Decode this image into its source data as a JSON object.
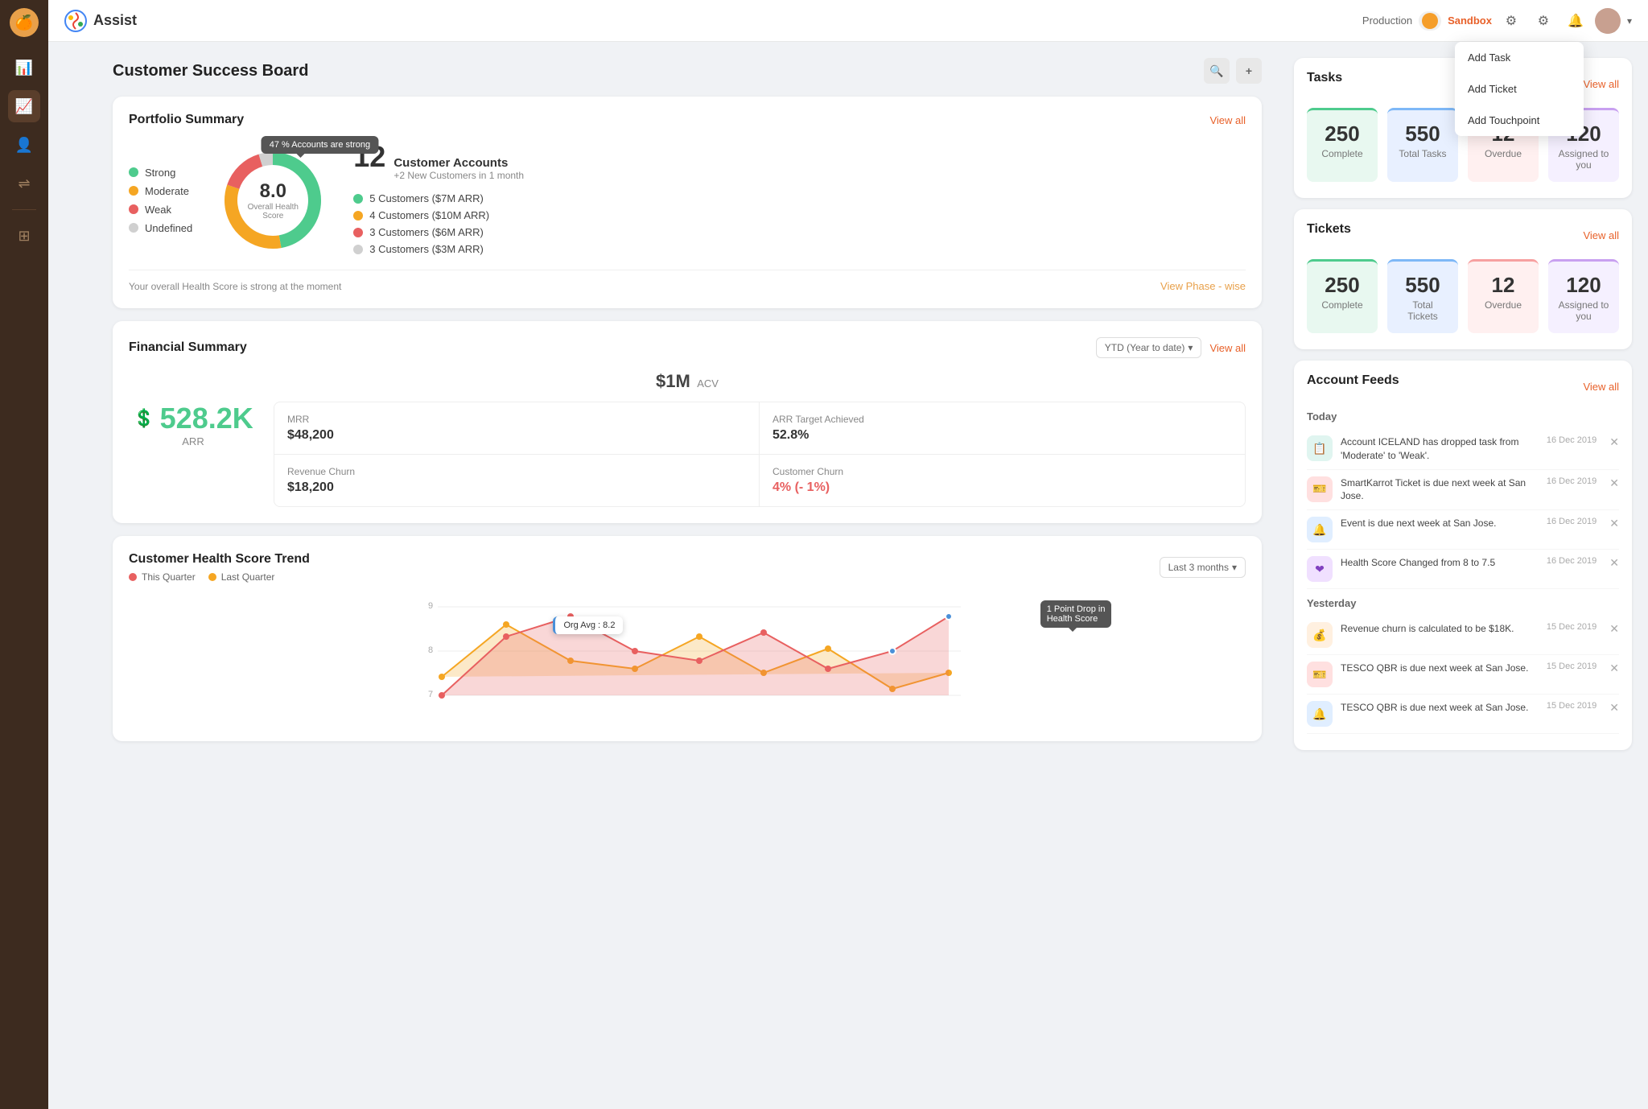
{
  "app": {
    "name": "Assist",
    "env_label": "Production",
    "env_active": "Sandbox"
  },
  "page": {
    "title": "Customer Success Board",
    "search_icon": "🔍",
    "add_icon": "+"
  },
  "sidebar": {
    "items": [
      {
        "id": "home",
        "icon": "⊞",
        "active": false
      },
      {
        "id": "dashboard",
        "icon": "📊",
        "active": true
      },
      {
        "id": "users",
        "icon": "👤",
        "active": false
      },
      {
        "id": "flows",
        "icon": "⇌",
        "active": false
      },
      {
        "id": "grid",
        "icon": "⊞",
        "active": false
      }
    ]
  },
  "dropdown_menu": {
    "items": [
      "Add Task",
      "Add Ticket",
      "Add Touchpoint"
    ]
  },
  "portfolio": {
    "title": "Portfolio Summary",
    "view_all": "View all",
    "tooltip": "47 % Accounts are strong",
    "health_score": "8.0",
    "health_label": "Overall Health Score",
    "footer_text": "Your overall Health Score is strong at the moment",
    "view_phase": "View Phase - wise",
    "legend": [
      {
        "label": "Strong",
        "color": "#4ecb8d"
      },
      {
        "label": "Moderate",
        "color": "#f5a623"
      },
      {
        "label": "Weak",
        "color": "#e86060"
      },
      {
        "label": "Undefined",
        "color": "#d0d0d0"
      }
    ],
    "accounts": {
      "count": "12",
      "title": "Customer Accounts",
      "subtitle": "+2 New Customers in 1 month",
      "items": [
        {
          "label": "5 Customers ($7M  ARR)",
          "color": "#4ecb8d"
        },
        {
          "label": "4 Customers ($10M ARR)",
          "color": "#f5a623"
        },
        {
          "label": "3 Customers ($6M  ARR)",
          "color": "#e86060"
        },
        {
          "label": "3 Customers ($3M  ARR)",
          "color": "#d0d0d0"
        }
      ]
    }
  },
  "tasks": {
    "title": "Tasks",
    "view_all": "View all",
    "stats": [
      {
        "value": "250",
        "label": "Complete",
        "style": "green"
      },
      {
        "value": "550",
        "label": "Total Tasks",
        "style": "blue"
      },
      {
        "value": "12",
        "label": "Overdue",
        "style": "red"
      },
      {
        "value": "120",
        "label": "Assigned to you",
        "style": "purple"
      }
    ]
  },
  "tickets": {
    "title": "Tickets",
    "view_all": "View all",
    "stats": [
      {
        "value": "250",
        "label": "Complete",
        "style": "green"
      },
      {
        "value": "550",
        "label": "Total Tickets",
        "style": "blue"
      },
      {
        "value": "12",
        "label": "Overdue",
        "style": "red"
      },
      {
        "value": "120",
        "label": "Assigned to you",
        "style": "purple"
      }
    ]
  },
  "financial": {
    "title": "Financial Summary",
    "view_all": "View all",
    "period": "YTD (Year to date)",
    "acv": "$1M",
    "acv_label": "ACV",
    "arr_amount": "528.2K",
    "arr_label": "ARR",
    "cells": [
      {
        "label": "MRR",
        "value": "$48,200"
      },
      {
        "label": "ARR Target Achieved",
        "value": "52.8%"
      },
      {
        "label": "Revenue Churn",
        "value": "$18,200"
      },
      {
        "label": "Customer Churn",
        "value": "4%  (- 1%)",
        "churn": true
      }
    ]
  },
  "health_trend": {
    "title": "Customer Health Score Trend",
    "period": "Last 3 months",
    "legend": [
      {
        "label": "This Quarter",
        "color": "#e86060"
      },
      {
        "label": "Last Quarter",
        "color": "#f5a623"
      }
    ],
    "y_labels": [
      "9",
      "8",
      "7"
    ],
    "tooltip_org": "Org Avg : 8.2",
    "tooltip_drop": "1 Point Drop in\nHealth Score"
  },
  "feeds": {
    "title": "Account Feeds",
    "view_all": "View all",
    "today_label": "Today",
    "yesterday_label": "Yesterday",
    "today_items": [
      {
        "icon": "📋",
        "icon_style": "teal",
        "text": "Account ICELAND has dropped  task from 'Moderate'  to 'Weak'.",
        "date": "16 Dec 2019"
      },
      {
        "icon": "🎫",
        "icon_style": "pink",
        "text": "SmartKarrot Ticket is due next week at San Jose.",
        "date": "16 Dec 2019"
      },
      {
        "icon": "🔔",
        "icon_style": "blue",
        "text": "Event is due next week at San Jose.",
        "date": "16 Dec 2019"
      },
      {
        "icon": "❤",
        "icon_style": "purple",
        "text": "Health Score Changed from 8 to 7.5",
        "date": "16 Dec 2019"
      }
    ],
    "yesterday_items": [
      {
        "icon": "💰",
        "icon_style": "orange",
        "text": "Revenue churn is calculated to be $18K.",
        "date": "15 Dec 2019"
      },
      {
        "icon": "🎫",
        "icon_style": "pink",
        "text": "TESCO QBR is due next week at San Jose.",
        "date": "15 Dec 2019"
      },
      {
        "icon": "🔔",
        "icon_style": "blue",
        "text": "TESCO QBR is due next week at San Jose.",
        "date": "15 Dec 2019"
      }
    ]
  }
}
